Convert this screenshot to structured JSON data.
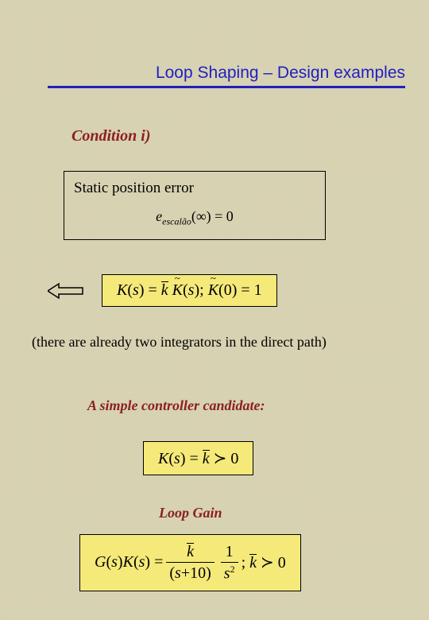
{
  "header": {
    "title": "Loop Shaping – Design examples"
  },
  "condition": {
    "label": "Condition  i)"
  },
  "errorBox": {
    "title": "Static position error",
    "equation": "e_escalão(∞) = 0"
  },
  "kDef": {
    "eq": "K(s) = k̄ K̃(s); K̃(0) = 1"
  },
  "note": "(there are already two integrators in the direct path)",
  "candidate": {
    "label": "A simple controller candidate:"
  },
  "kSimple": {
    "eq": "K(s) = k̄ ≻ 0"
  },
  "loopGain": {
    "label": "Loop Gain",
    "eq": "G(s)K(s) = k̄ / ((s+10) s²) ; k̄ ≻ 0"
  }
}
